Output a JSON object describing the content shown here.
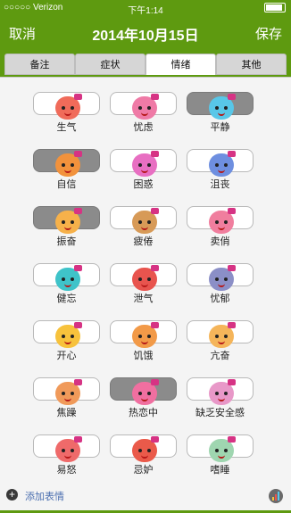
{
  "status_bar": {
    "carrier": "○○○○○ Verizon",
    "time": "下午1:14"
  },
  "nav": {
    "cancel": "取消",
    "title": "2014年10月15日",
    "save": "保存"
  },
  "tabs": [
    {
      "label": "备注",
      "active": false
    },
    {
      "label": "症状",
      "active": false
    },
    {
      "label": "情绪",
      "active": true
    },
    {
      "label": "其他",
      "active": false
    }
  ],
  "emotions": [
    {
      "label": "生气",
      "selected": false,
      "face": "#f06b5a"
    },
    {
      "label": "忧虑",
      "selected": false,
      "face": "#ef7aa6"
    },
    {
      "label": "平静",
      "selected": true,
      "face": "#58c7e8"
    },
    {
      "label": "自信",
      "selected": true,
      "face": "#f2923c"
    },
    {
      "label": "困惑",
      "selected": false,
      "face": "#e86fc2"
    },
    {
      "label": "沮丧",
      "selected": false,
      "face": "#6e8fe0"
    },
    {
      "label": "振奋",
      "selected": true,
      "face": "#f6b14a"
    },
    {
      "label": "疲倦",
      "selected": false,
      "face": "#d79a57"
    },
    {
      "label": "卖俏",
      "selected": false,
      "face": "#f07e9e"
    },
    {
      "label": "健忘",
      "selected": false,
      "face": "#3fc3c9"
    },
    {
      "label": "泄气",
      "selected": false,
      "face": "#e8544e"
    },
    {
      "label": "忧郁",
      "selected": false,
      "face": "#8b8fc7"
    },
    {
      "label": "开心",
      "selected": false,
      "face": "#f7c23c"
    },
    {
      "label": "饥饿",
      "selected": false,
      "face": "#f29a48"
    },
    {
      "label": "亢奋",
      "selected": false,
      "face": "#f5b55a"
    },
    {
      "label": "焦躁",
      "selected": false,
      "face": "#f09a5a"
    },
    {
      "label": "热恋中",
      "selected": true,
      "face": "#f06fa0"
    },
    {
      "label": "缺乏安全感",
      "selected": false,
      "face": "#e898c8"
    },
    {
      "label": "易怒",
      "selected": false,
      "face": "#ef6a6a"
    },
    {
      "label": "忌妒",
      "selected": false,
      "face": "#ea5a4a"
    },
    {
      "label": "嗜睡",
      "selected": false,
      "face": "#9fd6b0"
    }
  ],
  "footer": {
    "add_label": "添加表情"
  },
  "colors": {
    "brand": "#5e9a10",
    "selected_pill": "#8b8b8b"
  }
}
